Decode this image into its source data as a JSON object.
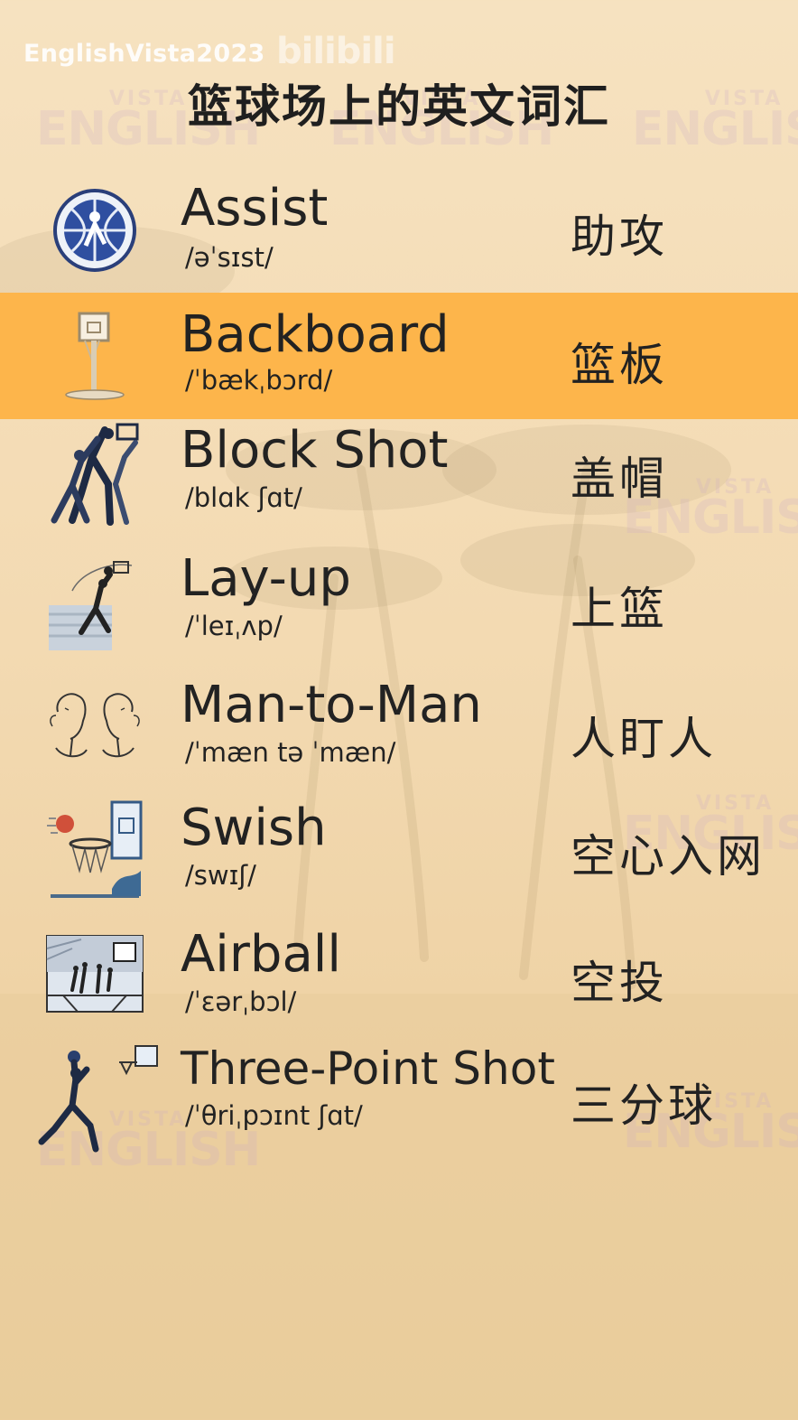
{
  "watermark": {
    "user": "EnglishVista2023",
    "logo": "bilibili"
  },
  "title": "篮球场上的英文词汇",
  "background_watermark": {
    "small": "VISTA",
    "big": "ENGLISH"
  },
  "colors": {
    "background": "#f4dcb5",
    "highlight": "#fdb54b",
    "text": "#222222"
  },
  "vocab": [
    {
      "word": "Assist",
      "phonetic": "/əˈsɪst/",
      "chinese": "助攻",
      "icon": "basketball-emblem-icon",
      "highlighted": false
    },
    {
      "word": "Backboard",
      "phonetic": "/ˈbækˌbɔrd/",
      "chinese": "篮板",
      "icon": "backboard-icon",
      "highlighted": true
    },
    {
      "word": "Block Shot",
      "phonetic": "/blɑk ʃɑt/",
      "chinese": "盖帽",
      "icon": "block-shot-players-icon",
      "highlighted": false
    },
    {
      "word": "Lay-up",
      "phonetic": "/ˈleɪˌʌp/",
      "chinese": "上篮",
      "icon": "layup-player-icon",
      "highlighted": false
    },
    {
      "word": "Man-to-Man",
      "phonetic": "/ˈmæn tə ˈmæn/",
      "chinese": "人盯人",
      "icon": "two-faces-icon",
      "highlighted": false
    },
    {
      "word": "Swish",
      "phonetic": "/swɪʃ/",
      "chinese": "空心入网",
      "icon": "ball-into-hoop-icon",
      "highlighted": false
    },
    {
      "word": "Airball",
      "phonetic": "/ˈɛərˌbɔl/",
      "chinese": "空投",
      "icon": "court-scene-icon",
      "highlighted": false
    },
    {
      "word": "Three-Point Shot",
      "phonetic": "/ˈθriˌpɔɪnt ʃɑt/",
      "chinese": "三分球",
      "icon": "jump-shot-player-icon",
      "highlighted": false
    }
  ]
}
